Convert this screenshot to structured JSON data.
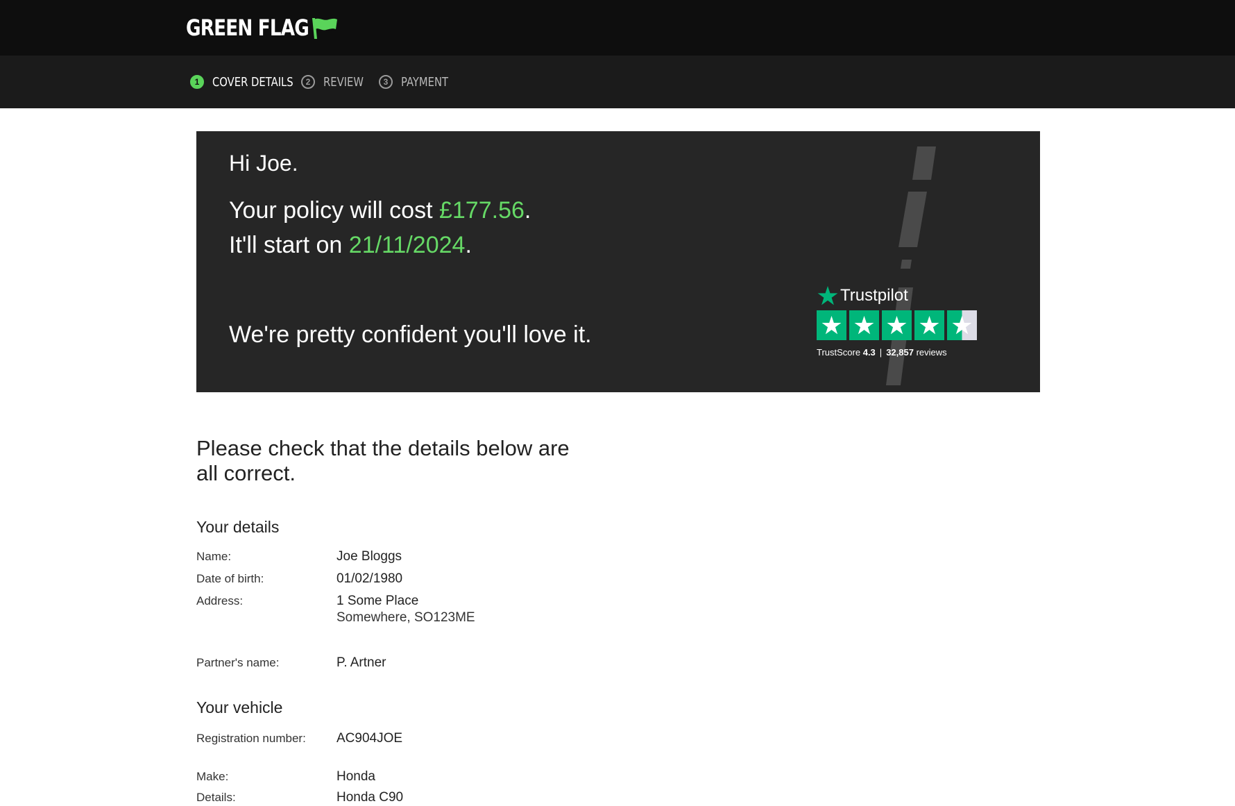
{
  "header": {
    "logo_text": "GREEN FLAG",
    "logo_icon": "flag-icon",
    "brand_green": "#5ad45a"
  },
  "steps": [
    {
      "number": "1",
      "label": "COVER DETAILS",
      "active": true
    },
    {
      "number": "2",
      "label": "REVIEW",
      "active": false
    },
    {
      "number": "3",
      "label": "PAYMENT",
      "active": false
    }
  ],
  "hero": {
    "greeting": "Hi Joe.",
    "cost_prefix": "Your policy will cost ",
    "cost_value": "£177.56",
    "cost_suffix": ".",
    "start_prefix": "It'll start on ",
    "start_value": "21/11/2024",
    "start_suffix": ".",
    "confident": "We're pretty confident you'll love it.",
    "highlight_color": "#66d966"
  },
  "trustpilot": {
    "brand": "Trustpilot",
    "score_label": "TrustScore",
    "score_value": "4.3",
    "separator": "|",
    "reviews_count": "32,857",
    "reviews_label": "reviews",
    "stars": 4.5,
    "star_color": "#00b67a"
  },
  "main": {
    "heading": "Please check that the details below are all correct.",
    "your_details": {
      "title": "Your details",
      "name_label": "Name:",
      "name_value": "Joe Bloggs",
      "dob_label": "Date of birth:",
      "dob_value": "01/02/1980",
      "address_label": "Address:",
      "address_line1": "1 Some Place",
      "address_line2": "Somewhere, SO123ME",
      "partner_label": "Partner's name:",
      "partner_value": "P. Artner"
    },
    "your_vehicle": {
      "title": "Your vehicle",
      "reg_label": "Registration number:",
      "reg_value": "AC904JOE",
      "make_label": "Make:",
      "make_value": "Honda",
      "details_label": "Details:",
      "details_value": "Honda C90"
    }
  }
}
